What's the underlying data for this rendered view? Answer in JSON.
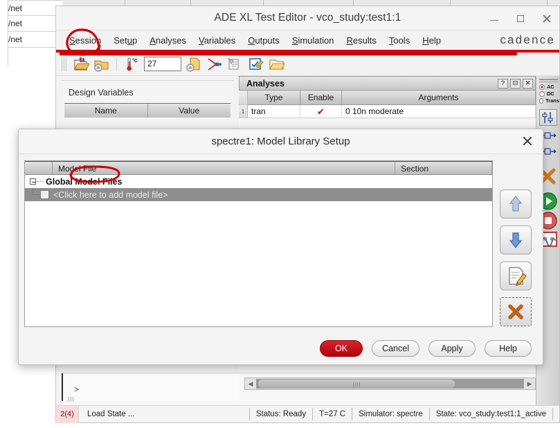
{
  "background": {
    "rows": [
      "/net",
      "/net",
      "/net"
    ]
  },
  "window": {
    "title": "ADE XL Test Editor - vco_study:test1:1",
    "controls": {
      "minimize": "minimize",
      "maximize": "maximize",
      "close": "close"
    },
    "brand": "cadence"
  },
  "menubar": {
    "items": [
      {
        "label": "Session",
        "accel": "S"
      },
      {
        "label": "Setup",
        "accel": "u"
      },
      {
        "label": "Analyses",
        "accel": "A"
      },
      {
        "label": "Variables",
        "accel": "V"
      },
      {
        "label": "Outputs",
        "accel": "O"
      },
      {
        "label": "Simulation",
        "accel": "S"
      },
      {
        "label": "Results",
        "accel": "R"
      },
      {
        "label": "Tools",
        "accel": "T"
      },
      {
        "label": "Help",
        "accel": "H"
      }
    ]
  },
  "toolbar": {
    "icons": [
      "open-state-icon",
      "save-state-icon",
      "temperature-icon",
      "setup-simulation-icon",
      "netlist-icon",
      "netlist-output-icon",
      "edit-netlist-icon",
      "open-results-icon"
    ],
    "temperature_value": "27",
    "temperature_unit": "°C"
  },
  "design_variables": {
    "title": "Design Variables",
    "columns": [
      "Name",
      "Value"
    ]
  },
  "analyses": {
    "title": "Analyses",
    "title_buttons": [
      "?",
      "⊟",
      "✕"
    ],
    "columns": [
      "Type",
      "Enable",
      "Arguments"
    ],
    "rows": [
      {
        "num": "1",
        "type": "tran",
        "enable": "✔",
        "arguments": "0 10n moderate"
      }
    ]
  },
  "rail": {
    "radios": [
      {
        "label": "AC",
        "selected": true
      },
      {
        "label": "DC",
        "selected": false
      },
      {
        "label": "Trans",
        "selected": false
      }
    ],
    "icons": [
      "sliders-icon",
      "net-probe-icon",
      "net-probe-icon",
      "delete-x-icon",
      "run-simulation-icon",
      "stop-simulation-icon",
      "waveform-plot-icon"
    ]
  },
  "log": {
    "prompt": ">"
  },
  "statusbar": {
    "count": "2(4)",
    "message": "Load State ...",
    "status": "Status: Ready",
    "temperature": "T=27  C",
    "simulator": "Simulator: spectre",
    "state": "State: vco_study:test1:1_active"
  },
  "dialog": {
    "title": "spectre1: Model Library Setup",
    "close": "close",
    "columns": [
      "Model File",
      "Section"
    ],
    "group_row": {
      "label": "Global Model Files",
      "expanded": true
    },
    "item_row": {
      "label": "<Click here to add model file>",
      "checked": false,
      "section": ""
    },
    "side_buttons": [
      "move-up-icon",
      "move-down-icon",
      "edit-icon",
      "delete-icon"
    ],
    "buttons": [
      {
        "label": "OK",
        "accel": "O",
        "primary": true
      },
      {
        "label": "Cancel",
        "accel": "C",
        "primary": false
      },
      {
        "label": "Apply",
        "accel": "A",
        "primary": false
      },
      {
        "label": "Help",
        "accel": "H",
        "primary": false
      }
    ]
  },
  "annotations": {
    "color": "#cc0000",
    "marks": [
      "circle-around-setup-menu",
      "arrow-line-under-menubar",
      "circle-around-model-file-header"
    ]
  }
}
